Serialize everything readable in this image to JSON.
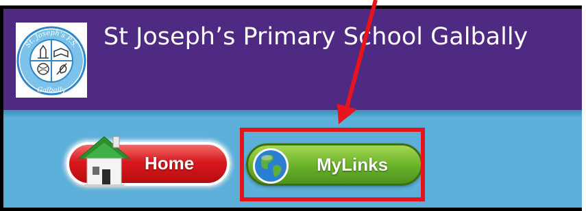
{
  "header": {
    "title": "St Joseph’s Primary School Galbally",
    "background_color": "#4e2a82",
    "logo": {
      "icon": "school-crest-icon",
      "text_top": "St. Joseph's P.S.",
      "text_bottom": "Galbally"
    }
  },
  "nav": {
    "background_color": "#5cb0d9",
    "buttons": [
      {
        "label": "Home",
        "icon": "house-icon",
        "color": "#d7191d"
      },
      {
        "label": "MyLinks",
        "icon": "globe-icon",
        "color": "#6cb52c"
      }
    ]
  },
  "annotation": {
    "highlight_color": "#e8141c",
    "highlighted": "MyLinks"
  }
}
